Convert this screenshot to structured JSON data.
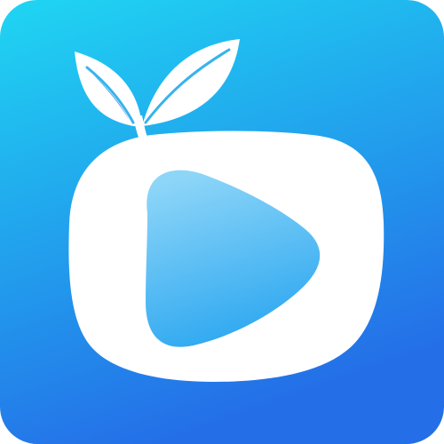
{
  "icon": {
    "name": "video-player-app-icon",
    "symbol": "play-icon",
    "decoration": "leaf-icon"
  },
  "colors": {
    "background_top": "#1fd6f2",
    "background_bottom": "#246fe8",
    "body": "#ffffff",
    "play_light": "#8ed6f8",
    "play_dark": "#2aa6f0"
  }
}
